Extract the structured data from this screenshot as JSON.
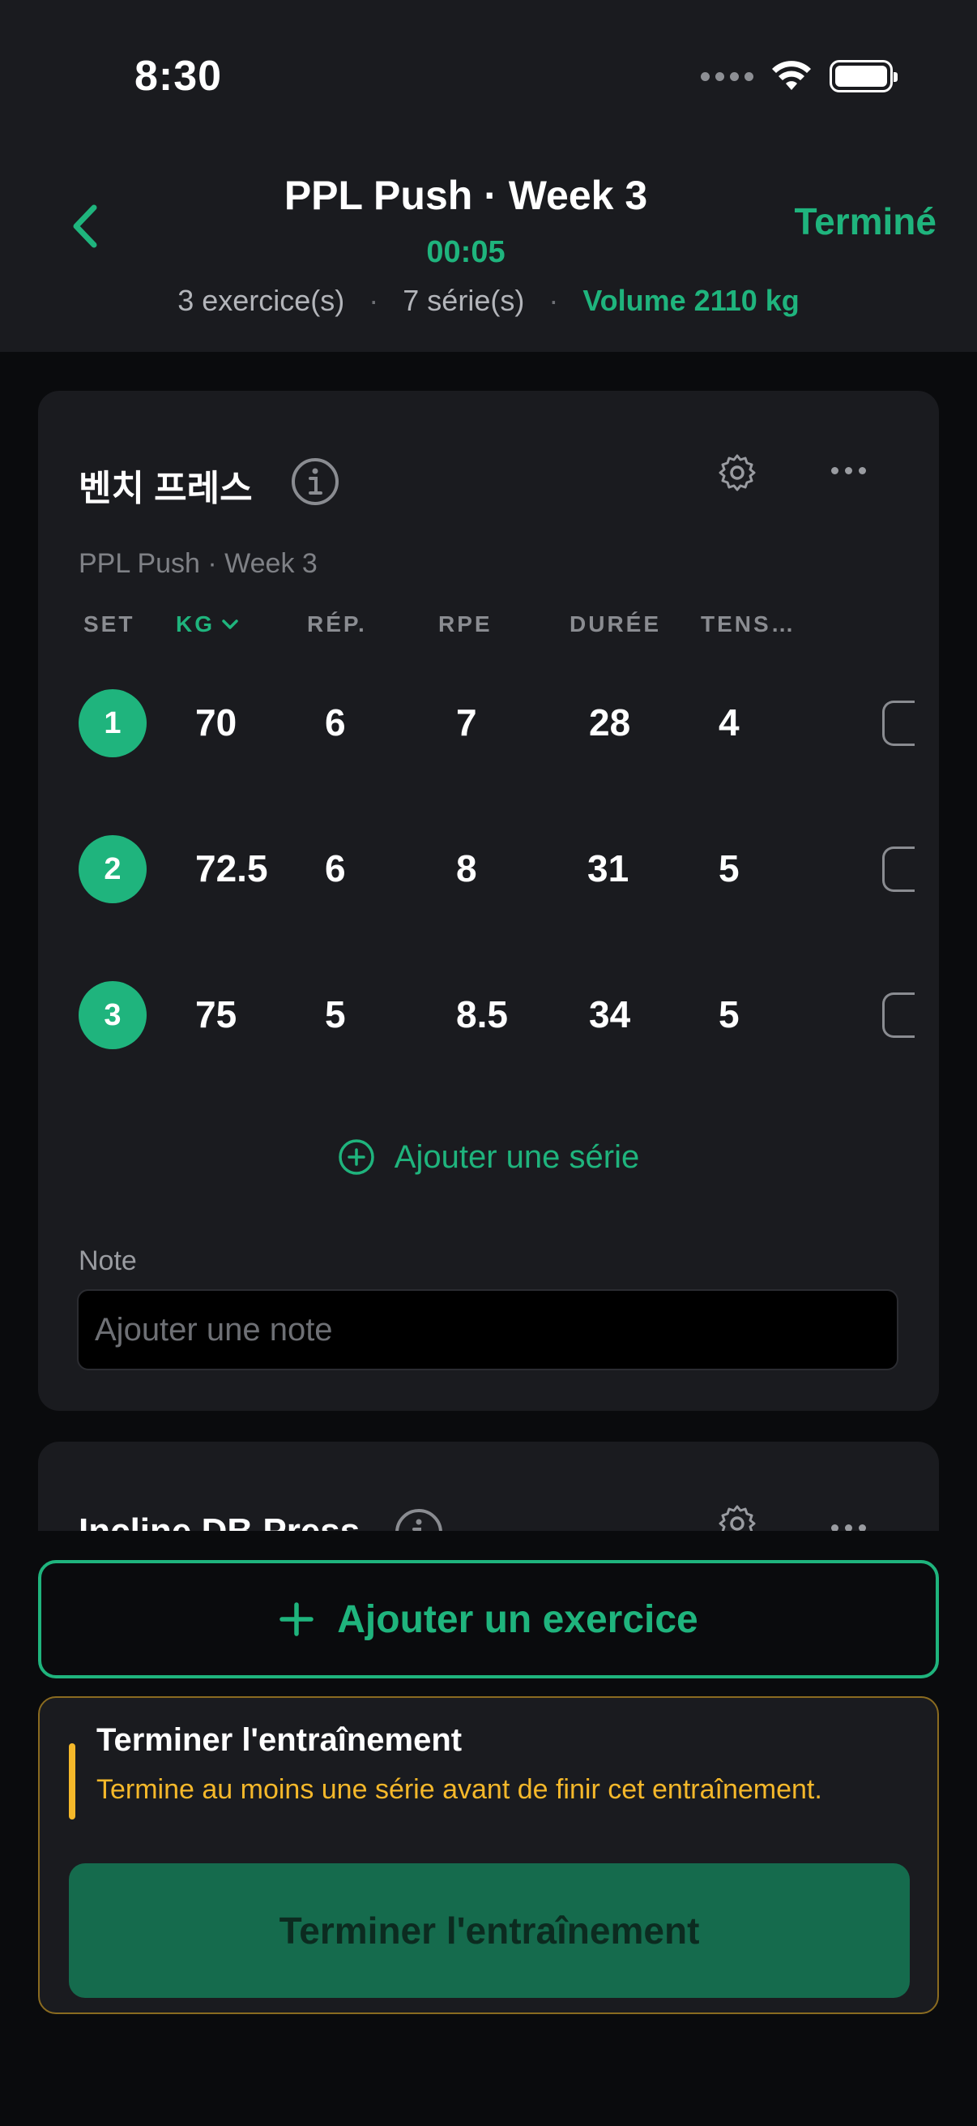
{
  "status_bar": {
    "time": "8:30"
  },
  "nav": {
    "title": "PPL Push · Week 3",
    "timer": "00:05",
    "done_label": "Terminé"
  },
  "summary": {
    "exercises": "3 exercice(s)",
    "sets": "7 série(s)",
    "volume": "Volume 2110 kg",
    "separator": "·"
  },
  "exercises": [
    {
      "name": "벤치 프레스",
      "subtitle": "PPL Push · Week 3",
      "columns": [
        "SET",
        "KG",
        "RÉP.",
        "RPE",
        "DURÉE",
        "TENS…"
      ],
      "rows": [
        {
          "set": "1",
          "kg": "70",
          "reps": "6",
          "rpe": "7",
          "duration": "28",
          "tension": "4"
        },
        {
          "set": "2",
          "kg": "72.5",
          "reps": "6",
          "rpe": "8",
          "duration": "31",
          "tension": "5"
        },
        {
          "set": "3",
          "kg": "75",
          "reps": "5",
          "rpe": "8.5",
          "duration": "34",
          "tension": "5"
        }
      ],
      "add_set_label": "Ajouter une série",
      "note_label": "Note",
      "note_placeholder": "Ajouter une note"
    },
    {
      "name": "Incline DB Press"
    }
  ],
  "actions": {
    "add_exercise_label": "Ajouter un exercice",
    "finish_title": "Terminer l'entraînement",
    "finish_message": "Termine au moins une série avant de finir cet entraînement.",
    "finish_button_label": "Terminer l'entraînement"
  },
  "colors": {
    "accent": "#1fb47d",
    "warning": "#f5b82a",
    "background": "#0a0b0d",
    "card": "#1a1b1f"
  },
  "icons": [
    "back-chevron-icon",
    "info-icon",
    "gear-icon",
    "more-icon",
    "add-circle-icon",
    "plus-icon",
    "wifi-icon",
    "battery-icon",
    "signal-dots-icon"
  ]
}
